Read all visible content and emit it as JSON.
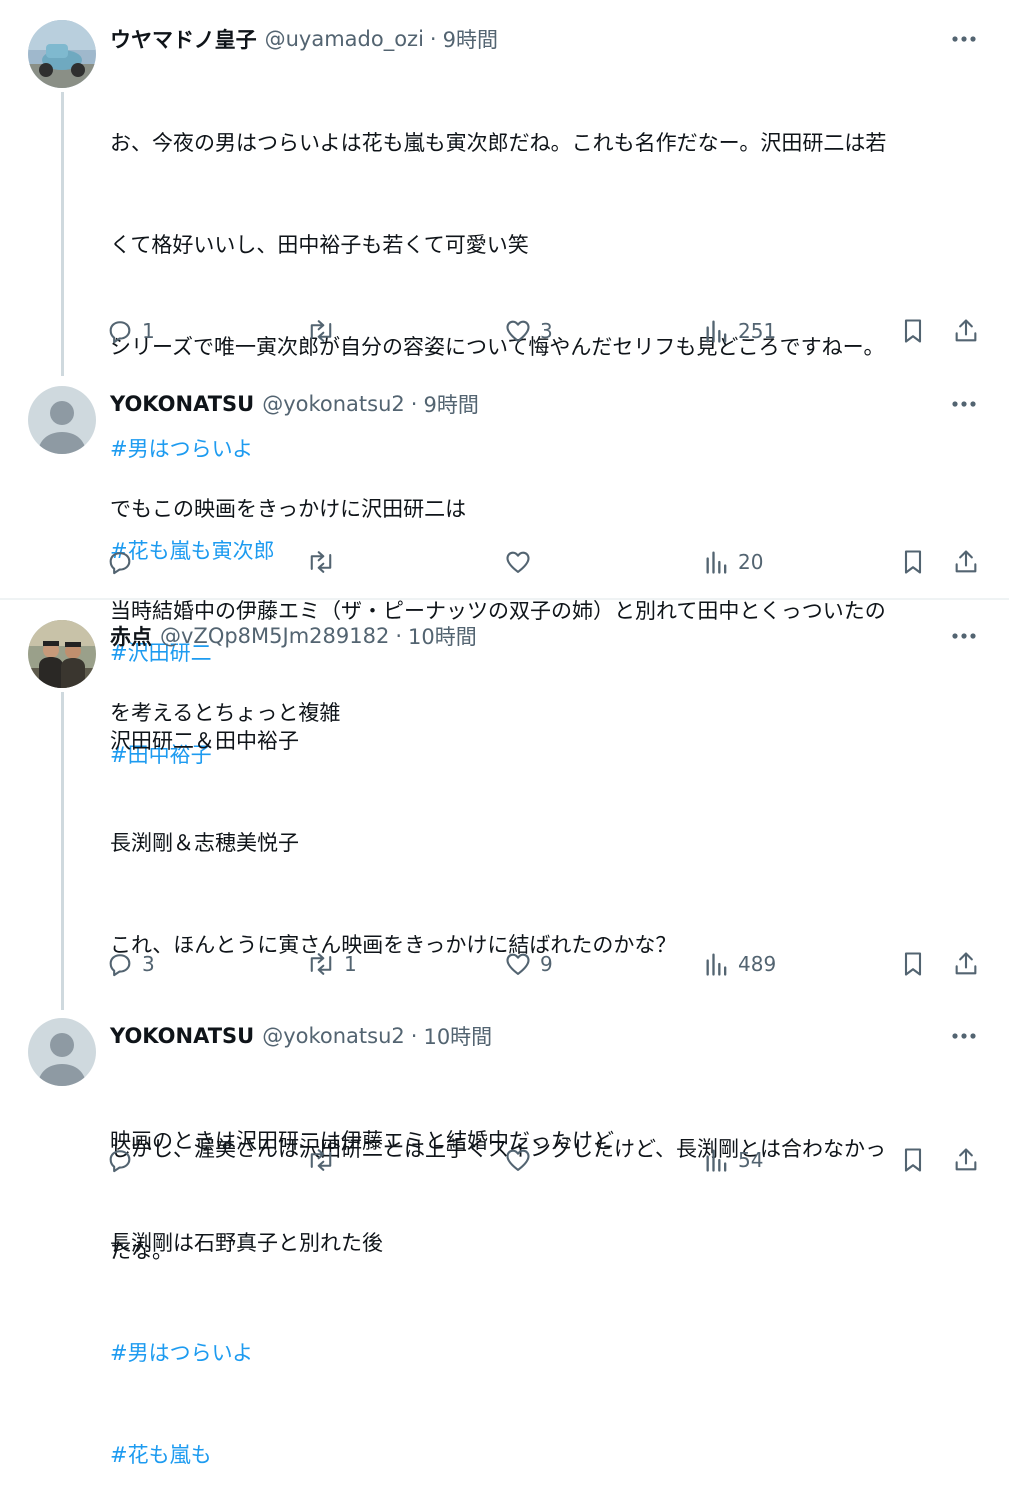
{
  "threads": [
    {
      "posts": [
        {
          "name": "ウヤマドノ皇子",
          "handle": "@uyamado_ozi",
          "time": "9時間",
          "lines": [
            {
              "text": "お、今夜の男はつらいよは花も嵐も寅次郎だね。これも名作だなー。沢田研二は若",
              "hashtag": false
            },
            {
              "text": "くて格好いいし、田中裕子も若くて可愛い笑",
              "hashtag": false
            },
            {
              "text": "シリーズで唯一寅次郎が自分の容姿について悔やんだセリフも見どころですねー。",
              "hashtag": false
            },
            {
              "text": "#男はつらいよ",
              "hashtag": true
            },
            {
              "text": "#花も嵐も寅次郎",
              "hashtag": true
            },
            {
              "text": "#沢田研二",
              "hashtag": true
            },
            {
              "text": "#田中裕子",
              "hashtag": true
            }
          ],
          "replies": "1",
          "reposts": "",
          "likes": "3",
          "views": "251"
        },
        {
          "name": "YOKONATSU",
          "handle": "@yokonatsu2",
          "time": "9時間",
          "lines": [
            {
              "text": "でもこの映画をきっかけに沢田研二は",
              "hashtag": false
            },
            {
              "text": "当時結婚中の伊藤エミ（ザ・ピーナッツの双子の姉）と別れて田中とくっついたの",
              "hashtag": false
            },
            {
              "text": "を考えるとちょっと複雑",
              "hashtag": false
            }
          ],
          "replies": "",
          "reposts": "",
          "likes": "",
          "views": "20"
        }
      ]
    },
    {
      "posts": [
        {
          "name": "赤点",
          "handle": "@vZQp8M5Jm289182",
          "time": "10時間",
          "lines": [
            {
              "text": "沢田研二＆田中裕子",
              "hashtag": false
            },
            {
              "text": "長渕剛＆志穂美悦子",
              "hashtag": false
            },
            {
              "text": "これ、ほんとうに寅さん映画をきっかけに結ばれたのかな？",
              "hashtag": false
            },
            {
              "text": "",
              "hashtag": false
            },
            {
              "text": "しかし、渥美さんは沢田研二とは上手くスイングしたけど、長渕剛とは合わなかっ",
              "hashtag": false
            },
            {
              "text": "たな。",
              "hashtag": false
            },
            {
              "text": " #男はつらいよ",
              "hashtag": true
            },
            {
              "text": " #花も嵐も",
              "hashtag": true
            }
          ],
          "replies": "3",
          "reposts": "1",
          "likes": "9",
          "views": "489"
        },
        {
          "name": "YOKONATSU",
          "handle": "@yokonatsu2",
          "time": "10時間",
          "lines": [
            {
              "text": "映画のときは沢田研二は伊藤エミと結婚中だったけど",
              "hashtag": false
            },
            {
              "text": "長渕剛は石野真子と別れた後",
              "hashtag": false
            }
          ],
          "replies": "",
          "reposts": "",
          "likes": "",
          "views": "54"
        }
      ]
    }
  ],
  "dot_separator": "·",
  "colors": {
    "text": "#0f1419",
    "secondary": "#536471",
    "link": "#1d9bf0",
    "thread_line": "#cfd9de",
    "divider": "#eff3f4"
  },
  "icons": [
    "reply-icon",
    "repost-icon",
    "like-icon",
    "views-icon",
    "bookmark-icon",
    "share-icon",
    "more-icon"
  ]
}
